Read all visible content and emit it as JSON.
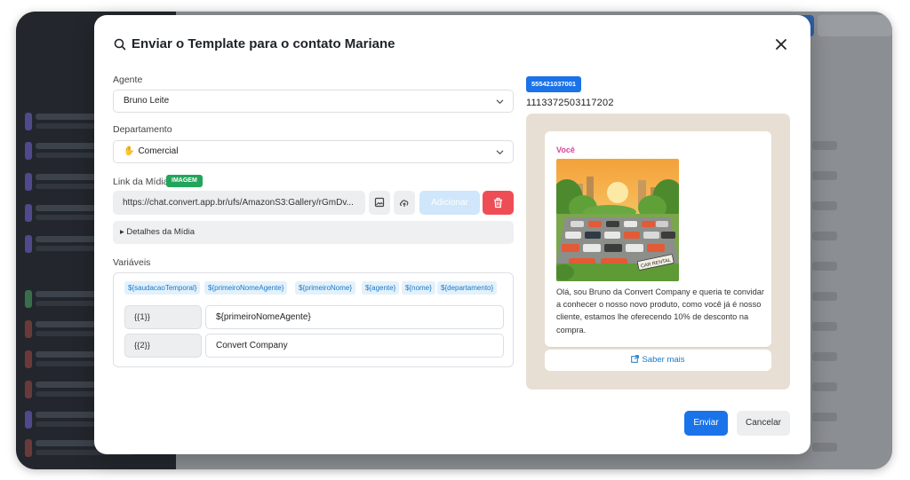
{
  "modal": {
    "title": "Enviar o Template para o contato Mariane"
  },
  "form": {
    "agent_label": "Agente",
    "agent_value": "Bruno Leite",
    "department_label": "Departamento",
    "department_value": "Comercial",
    "department_icon": "hand-icon",
    "media_link_label": "Link da Mídia",
    "media_type_badge": "IMAGEM",
    "media_url": "https://chat.convert.app.br/ufs/AmazonS3:Gallery/rGmDv...",
    "add_label": "Adicionar",
    "media_details_label": "▸ Detalhes da Mídia",
    "variables_label": "Variáveis",
    "variable_chips": [
      "${saudacaoTemporal}",
      "${primeiroNomeAgente}",
      "${primeiroNome}",
      "${agente}",
      "${nome}",
      "${departamento}"
    ],
    "variables": [
      {
        "key": "{{1}}",
        "value": "${primeiroNomeAgente}"
      },
      {
        "key": "{{2}}",
        "value": "Convert Company"
      }
    ]
  },
  "preview": {
    "number_badge": "555421037001",
    "phone": "1113372503117202",
    "sender": "Você",
    "image_caption": "CAR RENTAL",
    "message": "Olá, sou Bruno da Convert Company e queria te convidar a conhecer o nosso novo produto, como você já é nosso cliente, estamos lhe oferecendo 10% de desconto na compra.",
    "cta_label": "Saber mais"
  },
  "footer": {
    "send_label": "Enviar",
    "cancel_label": "Cancelar"
  },
  "colors": {
    "primary": "#1a73e8",
    "danger": "#ef4d56",
    "badge_green": "#22a55a",
    "sender_pink": "#d9469c"
  }
}
